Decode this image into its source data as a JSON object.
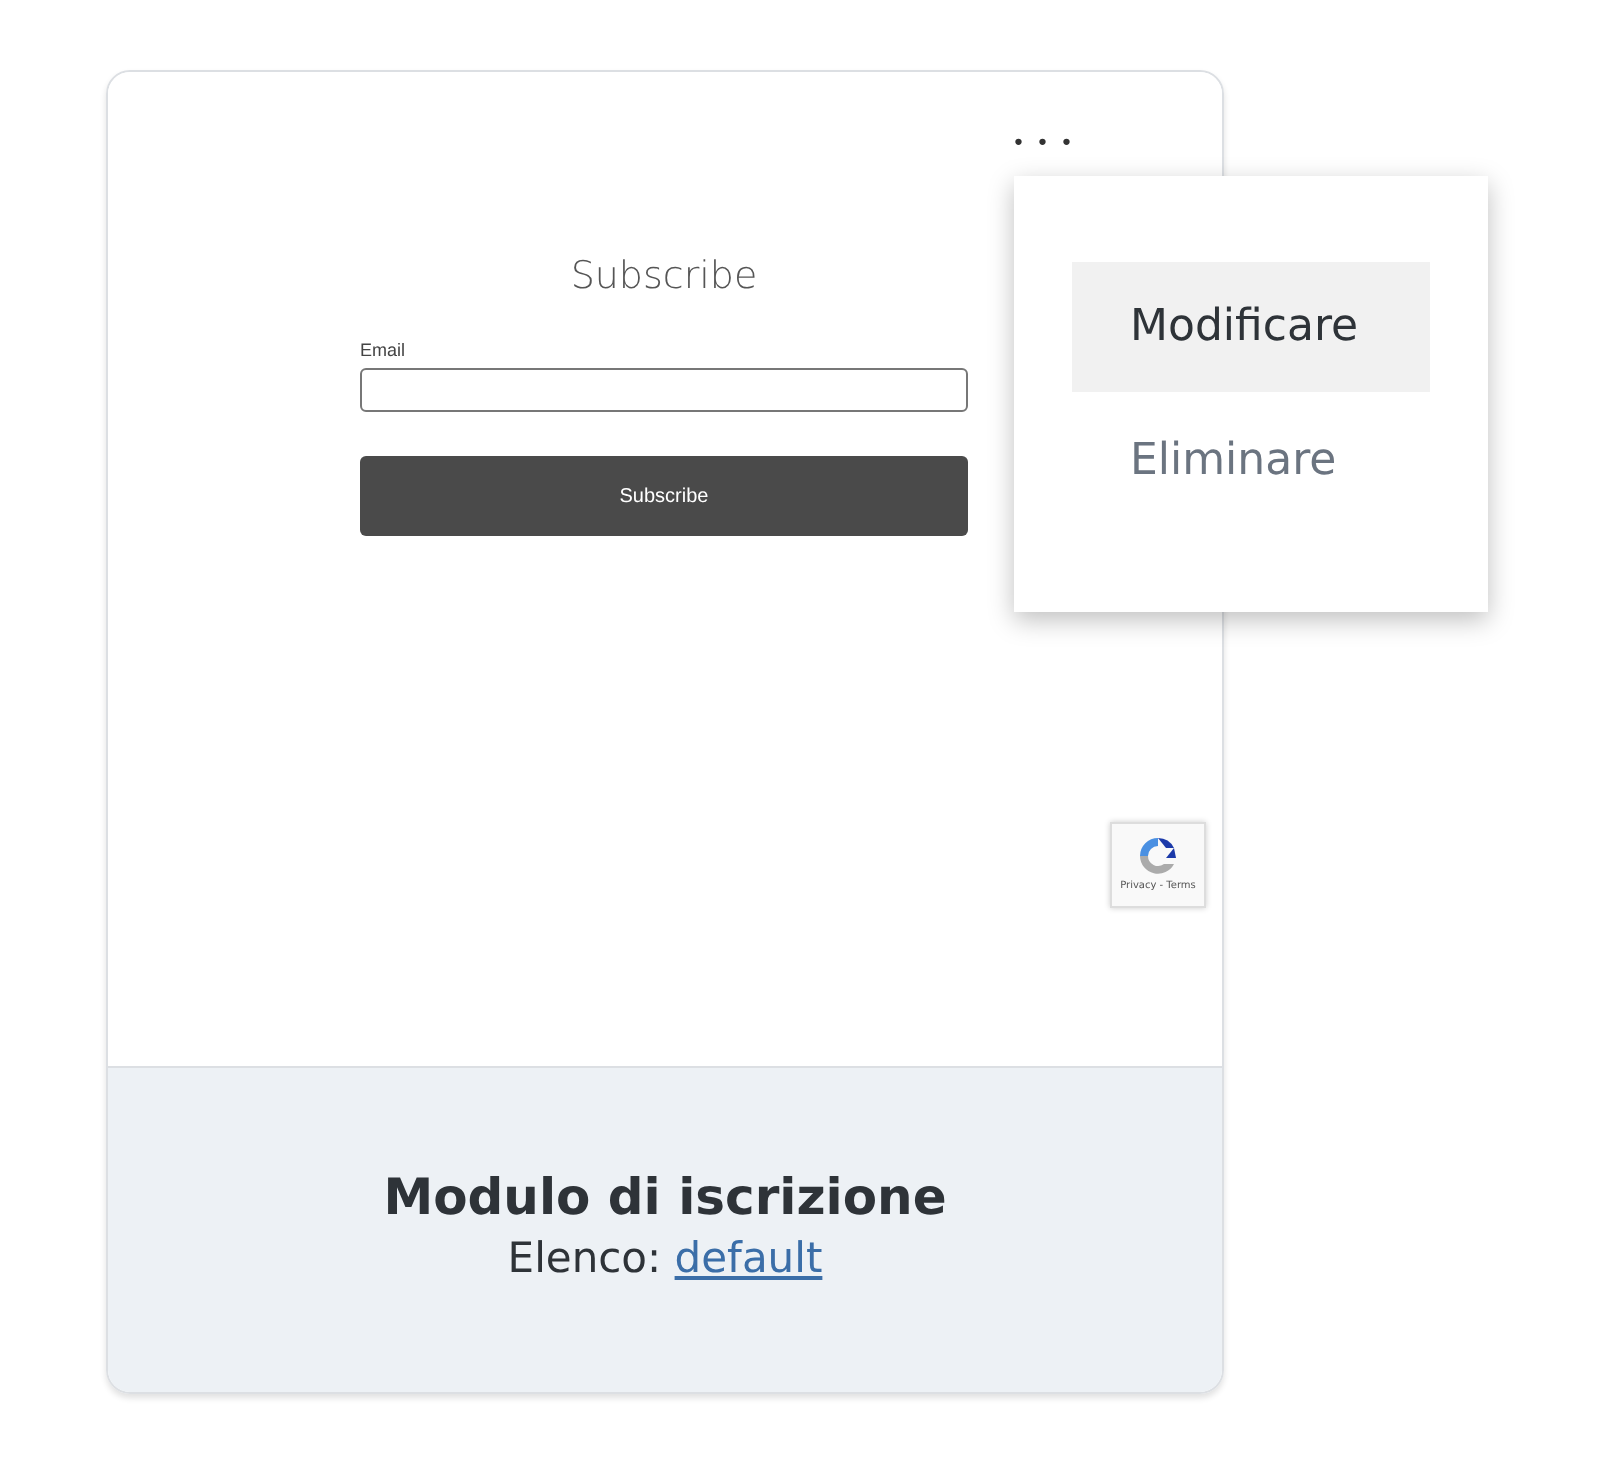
{
  "preview": {
    "title": "Subscribe",
    "field_label": "Email",
    "button": "Subscribe",
    "recaptcha": "Privacy - Terms"
  },
  "menu": {
    "trigger": "• • •",
    "items": [
      {
        "label": "Modificare",
        "selected": true
      },
      {
        "label": "Eliminare",
        "selected": false
      }
    ]
  },
  "footer": {
    "title": "Modulo di iscrizione",
    "list_label": "Elenco:",
    "list_link": "default"
  }
}
